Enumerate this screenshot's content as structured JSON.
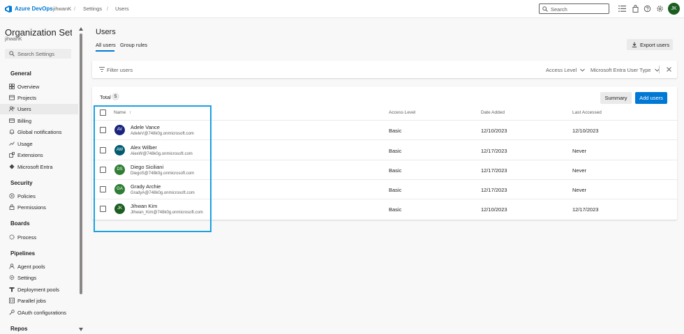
{
  "topbar": {
    "brand": "Azure DevOps",
    "crumbs": [
      "jihwanK",
      "Settings",
      "Users"
    ],
    "search_placeholder": "Search",
    "avatar": "JK"
  },
  "sidebar": {
    "title": "Organization Setti...",
    "subtitle": "jihwanK",
    "search_placeholder": "Search Settings",
    "sections": {
      "general": "General",
      "security": "Security",
      "boards": "Boards",
      "pipelines": "Pipelines",
      "repos": "Repos"
    },
    "items": {
      "overview": "Overview",
      "projects": "Projects",
      "users": "Users",
      "billing": "Billing",
      "global_notifications": "Global notifications",
      "usage": "Usage",
      "extensions": "Extensions",
      "microsoft_entra": "Microsoft Entra",
      "policies": "Policies",
      "permissions": "Permissions",
      "process": "Process",
      "agent_pools": "Agent pools",
      "settings": "Settings",
      "deployment_pools": "Deployment pools",
      "parallel_jobs": "Parallel jobs",
      "oauth_configurations": "OAuth configurations"
    }
  },
  "main": {
    "title": "Users",
    "tabs": [
      "All users",
      "Group rules"
    ],
    "export_label": "Export users",
    "filter_placeholder": "Filter users",
    "filter_access_level": "Access Level",
    "filter_user_type": "Microsoft Entra User Type",
    "total_label": "Total",
    "total_count": "5",
    "summary_label": "Summary",
    "add_users_label": "Add users",
    "columns": {
      "name": "Name",
      "sort_indicator": "↑",
      "access_level": "Access Level",
      "date_added": "Date Added",
      "last_accessed": "Last Accessed"
    },
    "users": [
      {
        "initials": "AV",
        "name": "Adele Vance",
        "email": "AdeleV@748k0g.onmicrosoft.com",
        "access": "Basic",
        "added": "12/10/2023",
        "last": "12/10/2023",
        "color": "#1a237e"
      },
      {
        "initials": "AW",
        "name": "Alex Wilber",
        "email": "AlexW@748k0g.onmicrosoft.com",
        "access": "Basic",
        "added": "12/17/2023",
        "last": "Never",
        "color": "#005b70"
      },
      {
        "initials": "DS",
        "name": "Diego Siciliani",
        "email": "DiegoS@748k0g.onmicrosoft.com",
        "access": "Basic",
        "added": "12/17/2023",
        "last": "Never",
        "color": "#2e7d32"
      },
      {
        "initials": "GA",
        "name": "Grady Archie",
        "email": "GradyA@748k0g.onmicrosoft.com",
        "access": "Basic",
        "added": "12/17/2023",
        "last": "Never",
        "color": "#2e7d32"
      },
      {
        "initials": "JK",
        "name": "Jihwan Kim",
        "email": "Jihwan_Kim@748k0g.onmicrosoft.com",
        "access": "Basic",
        "added": "12/10/2023",
        "last": "12/17/2023",
        "color": "#1b5e20"
      }
    ]
  },
  "colors": {
    "accent": "#0078d4",
    "highlight": "#1ba1e2"
  },
  "icons": [
    "azure-devops-logo",
    "search-icon",
    "list-icon",
    "bag-icon",
    "help-icon",
    "settings-icon",
    "filter-icon",
    "download-icon",
    "chevron-down-icon",
    "close-icon"
  ]
}
